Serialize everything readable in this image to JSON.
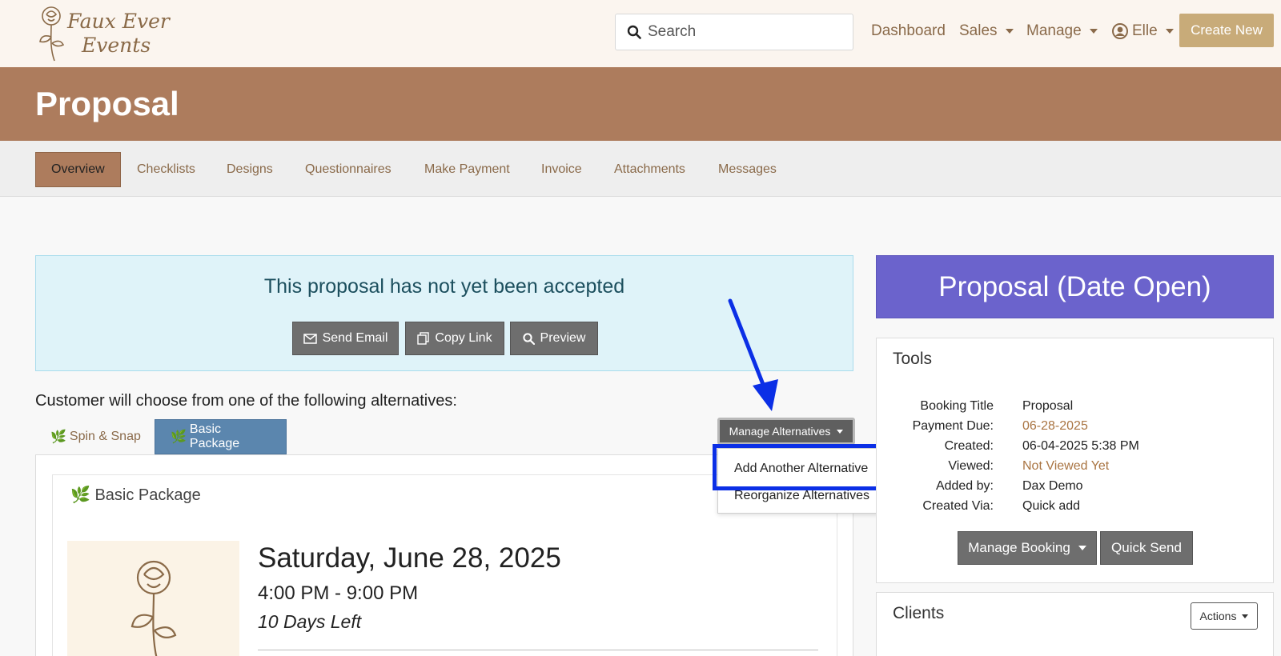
{
  "brand": {
    "logo_line1": "Faux Ever",
    "logo_line2": "Events"
  },
  "header": {
    "search_placeholder": "Search",
    "nav": {
      "dashboard": "Dashboard",
      "sales": "Sales",
      "manage": "Manage",
      "user": "Elle"
    },
    "create_new": "Create New"
  },
  "page": {
    "title": "Proposal"
  },
  "tabs": [
    {
      "label": "Overview",
      "active": true
    },
    {
      "label": "Checklists"
    },
    {
      "label": "Designs"
    },
    {
      "label": "Questionnaires"
    },
    {
      "label": "Make Payment"
    },
    {
      "label": "Invoice"
    },
    {
      "label": "Attachments"
    },
    {
      "label": "Messages"
    }
  ],
  "alert": {
    "message": "This proposal has not yet been accepted",
    "send_email": "Send Email",
    "copy_link": "Copy Link",
    "preview": "Preview"
  },
  "alternatives": {
    "prompt": "Customer will choose from one of the following alternatives:",
    "tabs": [
      "Spin & Snap",
      "Basic Package"
    ],
    "manage_label": "Manage Alternatives",
    "menu": {
      "add": "Add Another Alternative",
      "reorganize": "Reorganize Alternatives"
    }
  },
  "package": {
    "title": "Basic Package",
    "date": "Saturday, June 28, 2025",
    "time": "4:00 PM - 9:00 PM",
    "days_left": "10 Days Left"
  },
  "status": {
    "label": "Proposal (Date Open)",
    "color": "#6b63cc"
  },
  "tools": {
    "title": "Tools",
    "rows": [
      {
        "key": "Booking Title",
        "value": "Proposal"
      },
      {
        "key": "Payment Due:",
        "value": "06-28-2025"
      },
      {
        "key": "Created:",
        "value": "06-04-2025 5:38 PM"
      },
      {
        "key": "Viewed:",
        "value": "Not Viewed Yet"
      },
      {
        "key": "Added by:",
        "value": "Dax Demo"
      },
      {
        "key": "Created Via:",
        "value": "Quick add"
      }
    ],
    "manage_booking": "Manage Booking",
    "quick_send": "Quick Send"
  },
  "clients": {
    "title": "Clients",
    "actions": "Actions"
  },
  "colors": {
    "band": "#ad7c5d",
    "accent_gold": "#c8ab79",
    "alt_tab_active": "#5b86ae",
    "highlight": "#0b2fe6"
  }
}
